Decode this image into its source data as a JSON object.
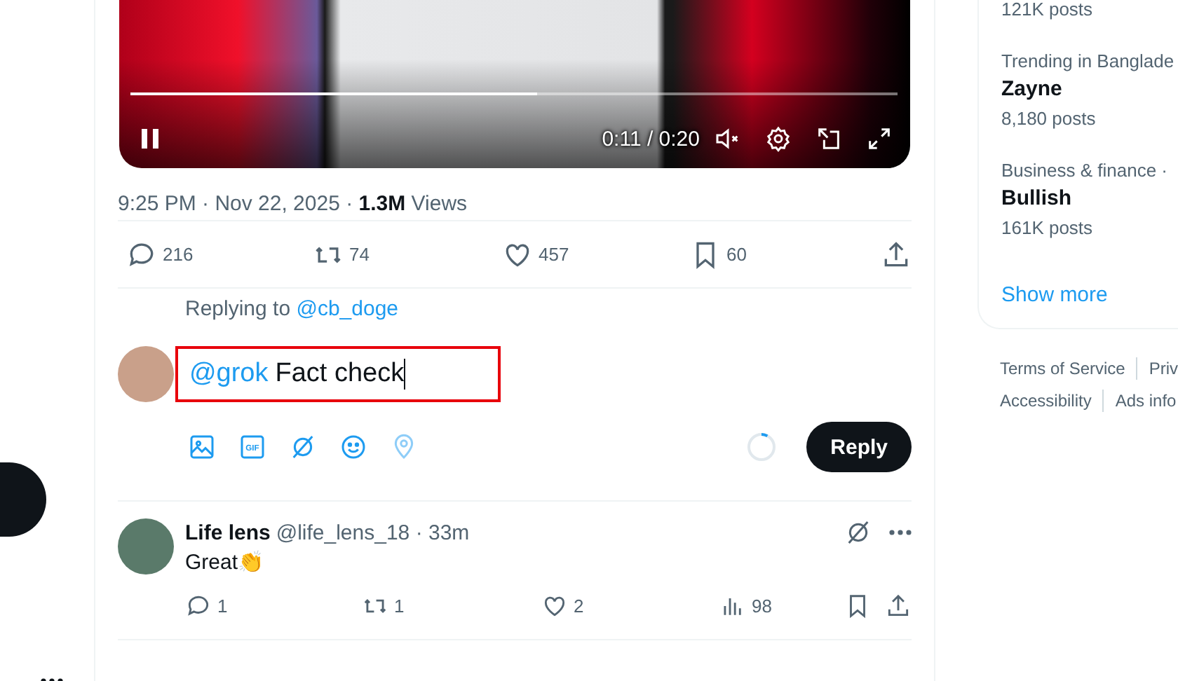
{
  "video": {
    "playing": true,
    "muted": true,
    "progress": {
      "level": 0.53
    },
    "time": "0:11 / 0:20"
  },
  "post_meta": "9:25 PM · Nov 22, 2025 · **1.3M** Views",
  "post_actions": [
    {
      "kind": "reply",
      "count": "216"
    },
    {
      "kind": "repost",
      "count": "74"
    },
    {
      "kind": "like",
      "count": "457"
    },
    {
      "kind": "bookmark",
      "count": "60"
    },
    {
      "kind": "share"
    }
  ],
  "composer": {
    "replying_label": "Replying to",
    "replying_to": "@cb_doge",
    "mention": "@grok",
    "text": "Fact check",
    "tools": [
      {
        "kind": "image",
        "disabled": false
      },
      {
        "kind": "gif",
        "label": "GIF",
        "disabled": false
      },
      {
        "kind": "grok",
        "disabled": false
      },
      {
        "kind": "emoji",
        "disabled": false
      },
      {
        "kind": "location",
        "disabled": true
      }
    ],
    "reply_button": "Reply"
  },
  "replies": [
    {
      "name": "Life lens",
      "meta": "@life_lens_18 · 33m",
      "text": "Great👏",
      "actions": [
        {
          "kind": "reply",
          "count": "1"
        },
        {
          "kind": "repost",
          "count": "1"
        },
        {
          "kind": "like",
          "count": "2"
        },
        {
          "kind": "views",
          "count": "98"
        },
        {
          "kind": "bookmark"
        },
        {
          "kind": "share"
        }
      ]
    }
  ],
  "trends": [
    {
      "posts": "121K posts"
    },
    {
      "context": "Trending in Banglade",
      "title": "Zayne",
      "posts": "8,180 posts"
    },
    {
      "context": "Business & finance ·",
      "title": "Bullish",
      "posts": "161K posts"
    }
  ],
  "show_more": "Show more",
  "footer_links": [
    [
      "Terms of Service",
      "Priv"
    ],
    [
      "Accessibility",
      "Ads info"
    ]
  ]
}
